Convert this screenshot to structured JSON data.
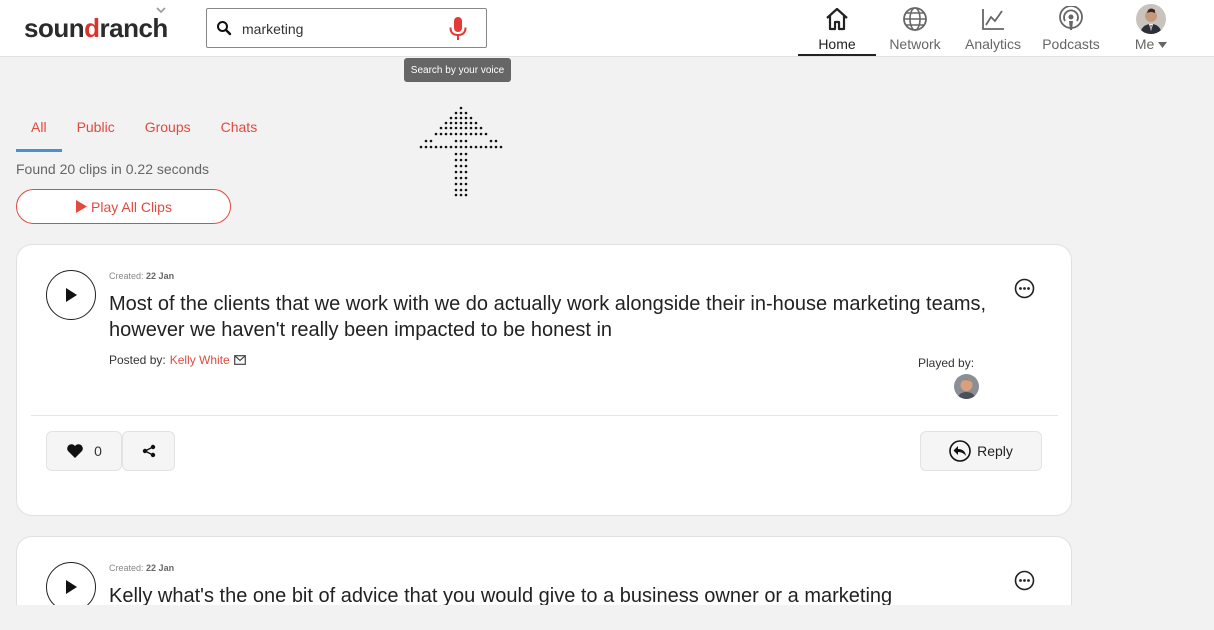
{
  "header": {
    "logo_pre": "soun",
    "logo_mid": "d",
    "logo_post": "ranch",
    "search": {
      "value": "marketing",
      "placeholder": ""
    },
    "tooltip": "Search by your voice",
    "nav": [
      {
        "label": "Home",
        "icon": "home-icon",
        "active": true
      },
      {
        "label": "Network",
        "icon": "globe-icon"
      },
      {
        "label": "Analytics",
        "icon": "chart-icon"
      },
      {
        "label": "Podcasts",
        "icon": "podcast-icon"
      },
      {
        "label": "Me",
        "icon": "avatar"
      }
    ]
  },
  "tabs": [
    "All",
    "Public",
    "Groups",
    "Chats"
  ],
  "results_text": "Found 20 clips in 0.22 seconds",
  "play_all_label": "Play All Clips",
  "clips": [
    {
      "created_label": "Created:",
      "created_date": "22 Jan",
      "text": "Most of the clients that we work with we do actually work alongside their in-house marketing teams, however we haven't really been impacted to be honest in",
      "posted_label": "Posted by:",
      "author": "Kelly White",
      "played_by_label": "Played by:",
      "likes": "0",
      "reply_label": "Reply"
    },
    {
      "created_label": "Created:",
      "created_date": "22 Jan",
      "text": "Kelly what's the one bit of advice that you would give to a business owner or a marketing"
    }
  ],
  "colors": {
    "accent": "#e04a3f",
    "tab_underline": "#4a90d9",
    "mic": "#e53935"
  }
}
